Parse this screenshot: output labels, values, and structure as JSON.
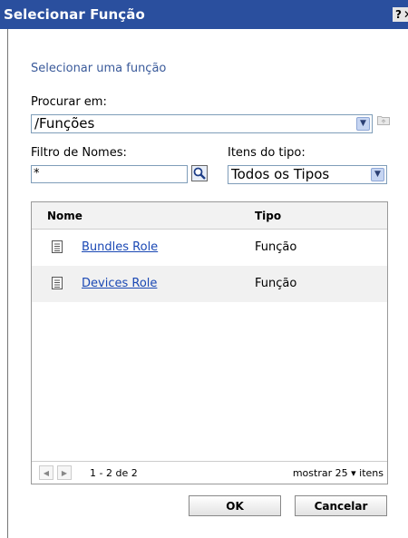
{
  "window": {
    "title": "Selecionar Função",
    "help_label": "?",
    "close_label": "✕"
  },
  "subtitle": "Selecionar uma função",
  "browse": {
    "label": "Procurar em:",
    "value": "/Funções"
  },
  "name_filter": {
    "label": "Filtro de Nomes:",
    "value": "*"
  },
  "item_type": {
    "label": "Itens do tipo:",
    "value": "Todos os Tipos"
  },
  "table": {
    "columns": [
      "Nome",
      "Tipo"
    ],
    "rows": [
      {
        "name": "Bundles Role",
        "type": "Função"
      },
      {
        "name": "Devices Role",
        "type": "Função"
      }
    ]
  },
  "pager": {
    "range": "1 - 2 de 2",
    "show_label": "mostrar",
    "page_size": "25",
    "items_label": "itens"
  },
  "buttons": {
    "ok": "OK",
    "cancel": "Cancelar"
  },
  "colors": {
    "titlebar": "#2a4f9e",
    "link": "#1a48b4",
    "subtitle": "#3a5a9a"
  }
}
